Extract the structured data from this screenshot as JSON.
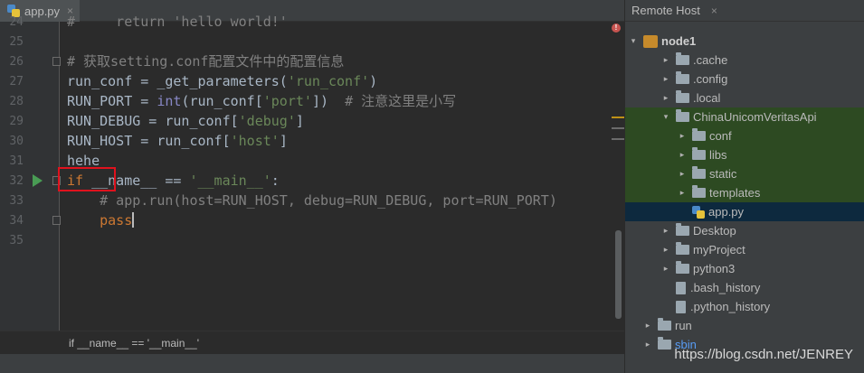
{
  "editor": {
    "tab": {
      "label": "app.py",
      "close": "×"
    },
    "lines": [
      {
        "n": "25",
        "text": ""
      },
      {
        "n": "26",
        "comment": "# 获取setting.conf配置文件中的配置信息"
      },
      {
        "n": "27",
        "a": "run_conf = _get_parameters(",
        "s": "'run_conf'",
        "b": ")"
      },
      {
        "n": "28",
        "a": "RUN_PORT = ",
        "bi": "int",
        "c": "(run_conf[",
        "s": "'port'",
        "b": "])  ",
        "comment": "# 注意这里是小写"
      },
      {
        "n": "29",
        "a": "RUN_DEBUG = run_conf[",
        "s": "'debug'",
        "b": "]"
      },
      {
        "n": "30",
        "a": "RUN_HOST = run_conf[",
        "s": "'host'",
        "b": "]"
      },
      {
        "n": "31",
        "a": "hehe"
      },
      {
        "n": "32",
        "kw": "if ",
        "a": "__name__ == ",
        "s": "'__main__'",
        "b": ":"
      },
      {
        "n": "33",
        "comment": "    # app.run(host=RUN_HOST, debug=RUN_DEBUG, port=RUN_PORT)"
      },
      {
        "n": "34",
        "kw": "    pass"
      },
      {
        "n": "35",
        "text": ""
      }
    ],
    "top_partial": {
      "n": "24",
      "text": "#     return 'hello world!'"
    },
    "breadcrumb": "if __name__ == '__main__'",
    "error_marker": "!"
  },
  "remote": {
    "title": "Remote Host",
    "close": "×",
    "tree": [
      {
        "label": "node1",
        "kind": "server",
        "indent": 0,
        "arrow": "▾",
        "bold": true
      },
      {
        "label": ".cache",
        "kind": "folder",
        "indent": 2,
        "arrow": "▸"
      },
      {
        "label": ".config",
        "kind": "folder",
        "indent": 2,
        "arrow": "▸"
      },
      {
        "label": ".local",
        "kind": "folder",
        "indent": 2,
        "arrow": "▸"
      },
      {
        "label": "ChinaUnicomVeritasApi",
        "kind": "folder",
        "indent": 2,
        "arrow": "▾",
        "style": "green"
      },
      {
        "label": "conf",
        "kind": "folder",
        "indent": 3,
        "arrow": "▸",
        "style": "green"
      },
      {
        "label": "libs",
        "kind": "folder",
        "indent": 3,
        "arrow": "▸",
        "style": "green"
      },
      {
        "label": "static",
        "kind": "folder",
        "indent": 3,
        "arrow": "▸",
        "style": "green"
      },
      {
        "label": "templates",
        "kind": "folder",
        "indent": 3,
        "arrow": "▸",
        "style": "green"
      },
      {
        "label": "app.py",
        "kind": "py",
        "indent": 3,
        "arrow": "",
        "style": "sel"
      },
      {
        "label": "Desktop",
        "kind": "folder",
        "indent": 2,
        "arrow": "▸"
      },
      {
        "label": "myProject",
        "kind": "folder",
        "indent": 2,
        "arrow": "▸"
      },
      {
        "label": "python3",
        "kind": "folder",
        "indent": 2,
        "arrow": "▸"
      },
      {
        "label": ".bash_history",
        "kind": "txt",
        "indent": 2,
        "arrow": ""
      },
      {
        "label": ".python_history",
        "kind": "txt",
        "indent": 2,
        "arrow": ""
      },
      {
        "label": "run",
        "kind": "folder",
        "indent": 1,
        "arrow": "▸"
      },
      {
        "label": "sbin",
        "kind": "folder",
        "indent": 1,
        "arrow": "▸",
        "blue": true
      }
    ]
  },
  "watermark": "https://blog.csdn.net/JENREY",
  "colors": {
    "green_band": "#2d4a22",
    "selection": "#0d293e",
    "highlight_box": "#e0121d"
  }
}
